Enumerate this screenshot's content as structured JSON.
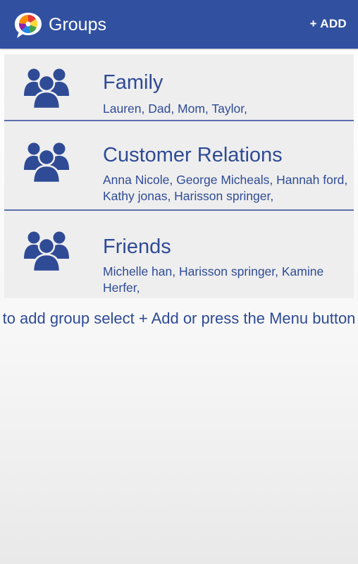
{
  "app": {
    "title": "Groups",
    "add_label": "+ ADD"
  },
  "groups": [
    {
      "name": "Family",
      "members": "Lauren, Dad, Mom, Taylor,"
    },
    {
      "name": "Customer Relations",
      "members": "Anna Nicole, George Micheals, Hannah ford, Kathy jonas, Harisson springer,"
    },
    {
      "name": "Friends",
      "members": "Michelle han, Harisson springer, Kamine Herfer,"
    }
  ],
  "hint": "to add group select + Add or press the Menu button",
  "colors": {
    "accent": "#3150a0",
    "text": "#2f4b96",
    "row_background": "#eeeeee"
  },
  "icons": {
    "logo": "app-logo-icon",
    "group": "group-people-icon"
  }
}
